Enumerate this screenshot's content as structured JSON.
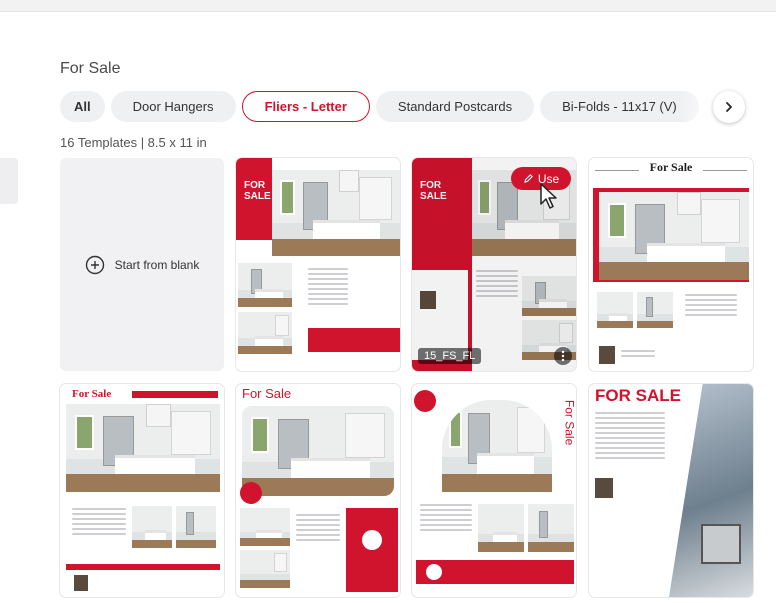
{
  "section": {
    "title": "For Sale"
  },
  "filters": [
    {
      "label": "All",
      "state": "selected"
    },
    {
      "label": "Door Hangers"
    },
    {
      "label": "Fliers - Letter",
      "state": "active"
    },
    {
      "label": "Standard Postcards"
    },
    {
      "label": "Bi-Folds - 11x17 (V)"
    }
  ],
  "count_text": "16 Templates | 8.5 x 11 in",
  "blank_card": {
    "label": "Start from blank"
  },
  "hover": {
    "use_label": "Use",
    "template_name": "15_FS_FL"
  },
  "templates": [
    {
      "heading": "FOR SALE"
    },
    {
      "heading": "FOR SALE"
    },
    {
      "heading": "For Sale"
    },
    {
      "heading": "For Sale"
    },
    {
      "heading": "For Sale"
    },
    {
      "heading": "For Sale"
    },
    {
      "heading": "FOR SALE"
    }
  ],
  "colors": {
    "brand_red": "#d0142d",
    "chip_bg": "#eff0f2",
    "card_bg": "#f1f1f3"
  }
}
